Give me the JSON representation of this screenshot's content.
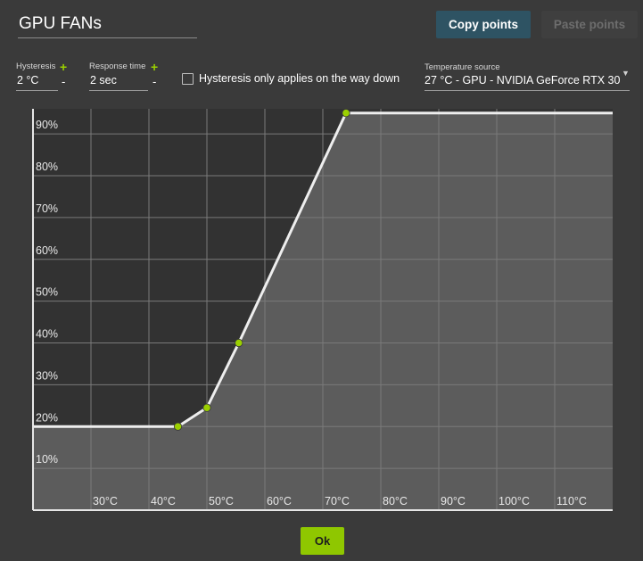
{
  "header": {
    "title": "GPU FANs",
    "copy_label": "Copy points",
    "paste_label": "Paste points"
  },
  "settings": {
    "hysteresis_label": "Hysteresis",
    "hysteresis_value": "2 °C",
    "response_label": "Response time",
    "response_value": "2 sec",
    "plus_glyph": "+",
    "minus_glyph": "-",
    "hysteresis_only_label": "Hysteresis only applies on the way down",
    "hysteresis_only_checked": false,
    "temp_source_label": "Temperature source",
    "temp_source_value": "27 °C - GPU - NVIDIA GeForce RTX 30"
  },
  "chart_data": {
    "type": "line",
    "x_tick_labels": [
      "30°C",
      "40°C",
      "50°C",
      "60°C",
      "70°C",
      "80°C",
      "90°C",
      "100°C",
      "110°C"
    ],
    "y_tick_labels": [
      "10%",
      "20%",
      "30%",
      "40%",
      "50%",
      "60%",
      "70%",
      "80%",
      "90%"
    ],
    "xlim": [
      20,
      120
    ],
    "ylim": [
      0,
      96
    ],
    "x_ticks": [
      30,
      40,
      50,
      60,
      70,
      80,
      90,
      100,
      110
    ],
    "y_ticks": [
      10,
      20,
      30,
      40,
      50,
      60,
      70,
      80,
      90
    ],
    "points": [
      {
        "x": 45,
        "y": 20
      },
      {
        "x": 50,
        "y": 24.5
      },
      {
        "x": 55.5,
        "y": 40
      },
      {
        "x": 74,
        "y": 95
      }
    ],
    "line_start_x": 20,
    "line_end_x": 120,
    "colors": {
      "background_dark": "#323232",
      "fill_area": "#5c5c5c",
      "grid": "#7a7a7a",
      "curve": "#eeeeee",
      "point": "#9bd000"
    }
  },
  "footer": {
    "ok_label": "Ok"
  }
}
